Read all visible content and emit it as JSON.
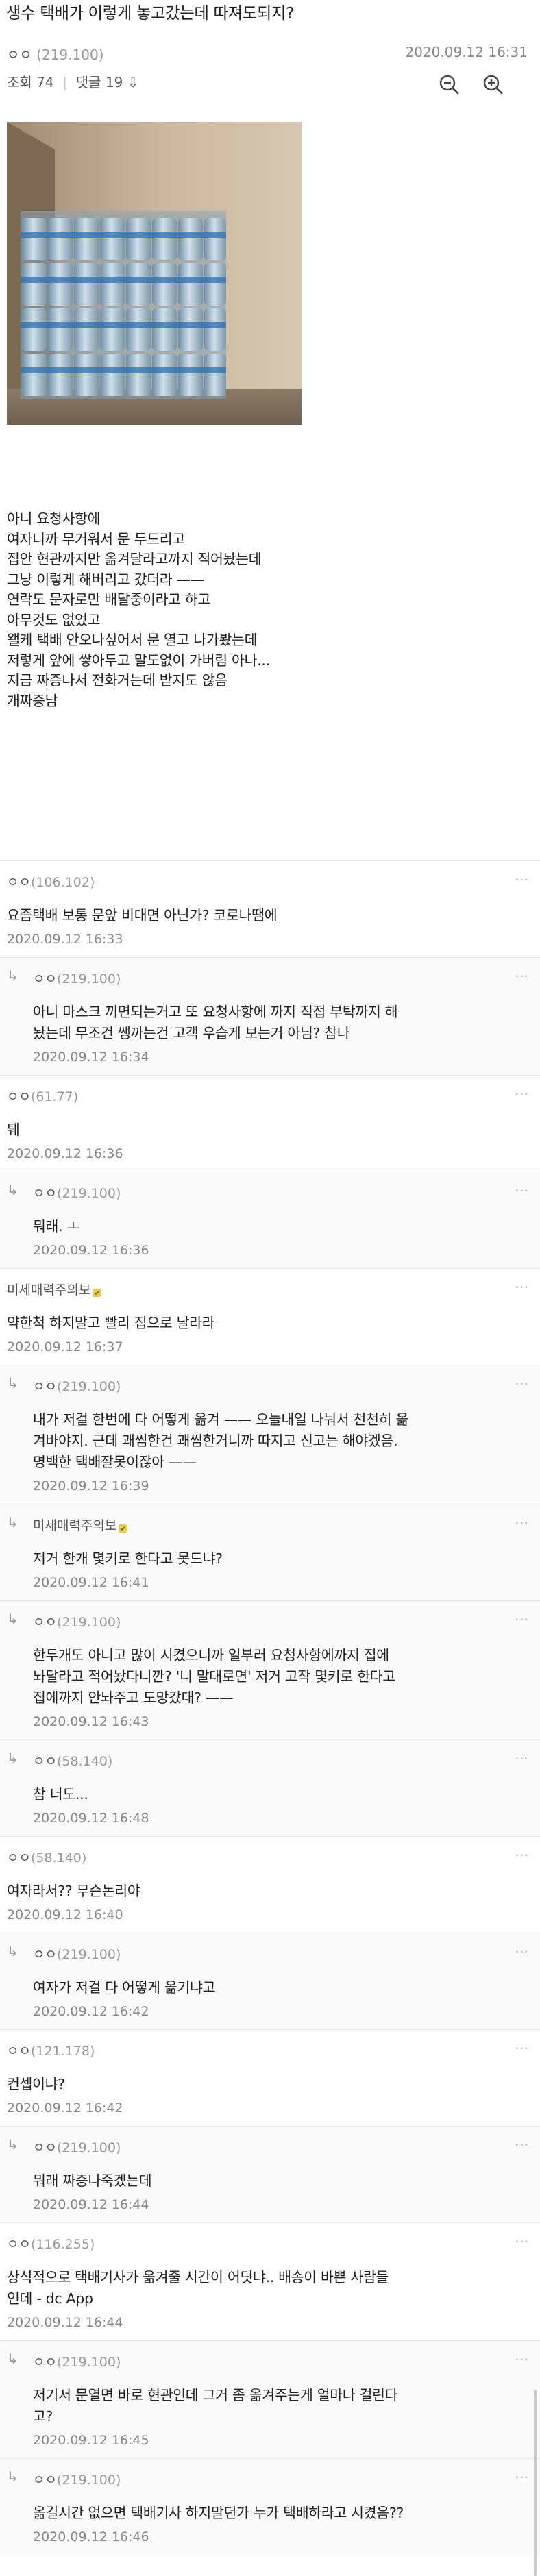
{
  "post": {
    "title": "생수 택배가 이렇게 놓고갔는데 따져도되지?",
    "author_glyph": "ㅇㅇ",
    "author_ip": "(219.100)",
    "date": "2020.09.12 16:31",
    "views_label": "조회 74",
    "comments_label": "댓글 19",
    "body_lines": [
      "아니 요청사항에",
      "여자니까 무거워서 문 두드리고",
      "집안 현관까지만  옮겨달라고까지 적어놨는데",
      "그냥 이렇게 해버리고 갔더라 ——",
      "연락도 문자로만 배달중이라고 하고",
      "아무것도 없었고",
      "왤케 택배 안오나싶어서 문 열고 나가봤는데",
      "저렇게 앞에 쌓아두고 말도없이 가버림 아나...",
      "지금 짜증나서 전화거는데 받지도 않음",
      "개짜증남"
    ]
  },
  "comments": [
    {
      "name": "ㅇㅇ",
      "ip": "(106.102)",
      "reply": false,
      "lines": [
        "요즘택배 보통 문앞 비대면 아닌가? 코로나땜에"
      ],
      "time": "2020.09.12 16:33"
    },
    {
      "name": "ㅇㅇ",
      "ip": "(219.100)",
      "reply": true,
      "lines": [
        "아니 마스크 끼면되는거고 또  요청사항에 까지 직접 부탁까지 해",
        "놨는데 무조건 쌩까는건 고객 우습게 보는거 아님? 참나"
      ],
      "time": "2020.09.12 16:34"
    },
    {
      "name": "ㅇㅇ",
      "ip": "(61.77)",
      "reply": false,
      "lines": [
        "퉤"
      ],
      "time": "2020.09.12 16:36"
    },
    {
      "name": "ㅇㅇ",
      "ip": "(219.100)",
      "reply": true,
      "lines": [
        "뭐래.  ㅗ"
      ],
      "time": "2020.09.12 16:36"
    },
    {
      "name": "미세매력주의보",
      "ip": "",
      "reply": false,
      "lines": [
        "약한척 하지말고 빨리 집으로 날라라"
      ],
      "time": "2020.09.12 16:37"
    },
    {
      "name": "ㅇㅇ",
      "ip": "(219.100)",
      "reply": true,
      "lines": [
        "내가 저걸 한번에 다 어떻게 옮겨 —— 오늘내일 나눠서 천천히 옮",
        "겨바야지. 근데 괘씸한건 괘씸한거니까 따지고 신고는 해야겠음.",
        "명백한 택배잘못이잖아 ——"
      ],
      "time": "2020.09.12 16:39"
    },
    {
      "name": "미세매력주의보",
      "ip": "",
      "reply": true,
      "lines": [
        "저거 한개 몇키로 한다고 못드냐?"
      ],
      "time": "2020.09.12 16:41"
    },
    {
      "name": "ㅇㅇ",
      "ip": "(219.100)",
      "reply": true,
      "lines": [
        "한두개도 아니고 많이 시켰으니까 일부러 요청사항에까지 집에",
        "놔달라고 적어놨다니깐?  '니 말대로면'  저거 고작 몇키로 한다고",
        "집에까지 안놔주고 도망갔대? ——"
      ],
      "time": "2020.09.12 16:43"
    },
    {
      "name": "ㅇㅇ",
      "ip": "(58.140)",
      "reply": true,
      "lines": [
        "참 너도..."
      ],
      "time": "2020.09.12 16:48"
    },
    {
      "name": "ㅇㅇ",
      "ip": "(58.140)",
      "reply": false,
      "lines": [
        "여자라서??  무슨논리야"
      ],
      "time": "2020.09.12 16:40"
    },
    {
      "name": "ㅇㅇ",
      "ip": "(219.100)",
      "reply": true,
      "lines": [
        "여자가 저걸 다 어떻게 옮기냐고"
      ],
      "time": "2020.09.12 16:42"
    },
    {
      "name": "ㅇㅇ",
      "ip": "(121.178)",
      "reply": false,
      "lines": [
        "컨셉이냐?"
      ],
      "time": "2020.09.12 16:42"
    },
    {
      "name": "ㅇㅇ",
      "ip": "(219.100)",
      "reply": true,
      "lines": [
        "뭐래 짜증나죽겠는데"
      ],
      "time": "2020.09.12 16:44"
    },
    {
      "name": "ㅇㅇ",
      "ip": "(116.255)",
      "reply": false,
      "lines": [
        "상식적으로 택배기사가 옮겨줄 시간이 어딧냐.. 배송이 바쁜 사람들",
        "인데  - dc App"
      ],
      "time": "2020.09.12 16:44"
    },
    {
      "name": "ㅇㅇ",
      "ip": "(219.100)",
      "reply": true,
      "lines": [
        "저기서 문열면 바로 현관인데 그거 좀 옮겨주는게 얼마나 걸린다",
        "고?"
      ],
      "time": "2020.09.12 16:45"
    },
    {
      "name": "ㅇㅇ",
      "ip": "(219.100)",
      "reply": true,
      "lines": [
        "옮길시간 없으면 택배기사 하지말던가 누가 택배하라고 시켰음??"
      ],
      "time": "2020.09.12 16:46"
    }
  ],
  "ui": {
    "zoom_out_icon": "zoom-out-icon",
    "zoom_in_icon": "zoom-in-icon",
    "reply_arrow_glyph": "↳",
    "more_glyph": "⋯",
    "comments_sort_glyph": "⇩"
  }
}
